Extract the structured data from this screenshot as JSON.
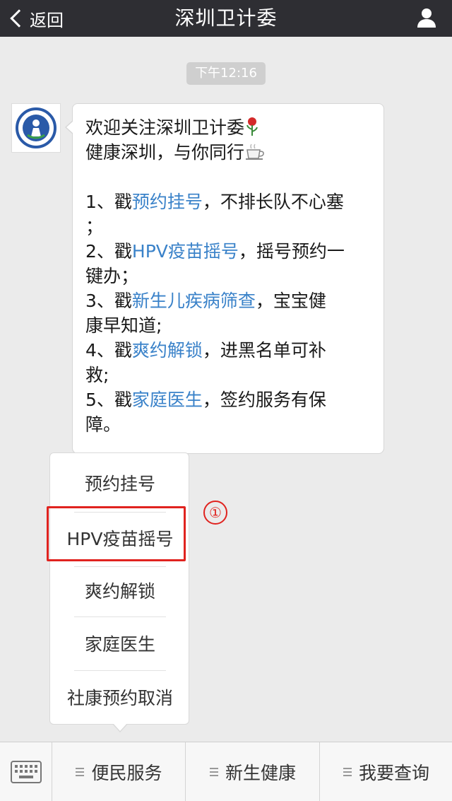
{
  "navbar": {
    "back_label": "返回",
    "title": "深圳卫计委",
    "profile_icon": "person-icon"
  },
  "timestamp": "下午12:16",
  "message": {
    "line1": "欢迎关注深圳卫计委",
    "line2": "健康深圳，与你同行",
    "item1_prefix": "1、戳",
    "item1_link": "预约挂号",
    "item1_rest": "，不排长队不心塞",
    "item1_cont": "；",
    "item2_prefix": "2、戳",
    "item2_link": "HPV疫苗摇号",
    "item2_rest": "，摇号预约一",
    "item2_cont": "键办；",
    "item3_prefix": "3、戳",
    "item3_link": "新生儿疾病筛查",
    "item3_rest": "，宝宝健",
    "item3_cont": "康早知道;",
    "item4_prefix": "4、戳",
    "item4_link": "爽约解锁",
    "item4_rest": "，进黑名单可补",
    "item4_cont": "救;",
    "item5_prefix": "5、戳",
    "item5_link": "家庭医生",
    "item5_rest": "，签约服务有保",
    "item5_cont": "障。",
    "link_color": "#3a82c9"
  },
  "popup_menu": {
    "items": [
      "预约挂号",
      "HPV疫苗摇号",
      "爽约解锁",
      "家庭医生",
      "社康预约取消"
    ]
  },
  "annotation": {
    "step_marker": "①",
    "color": "#e0231f"
  },
  "bottom_menu": {
    "keyboard_icon": "keyboard-icon",
    "tabs": [
      "便民服务",
      "新生健康",
      "我要查询"
    ]
  }
}
